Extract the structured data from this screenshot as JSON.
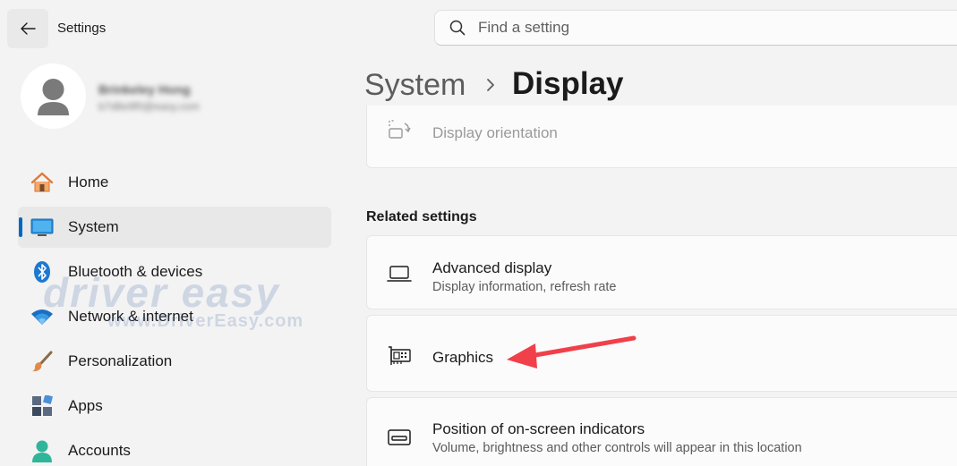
{
  "app": {
    "title": "Settings"
  },
  "search": {
    "placeholder": "Find a setting"
  },
  "profile": {
    "name": "Brinkeley Hong",
    "email": "b7d8e9f0@easy.com"
  },
  "sidebar": {
    "items": [
      {
        "label": "Home",
        "icon": "home-icon",
        "active": false
      },
      {
        "label": "System",
        "icon": "system-monitor-icon",
        "active": true
      },
      {
        "label": "Bluetooth & devices",
        "icon": "bluetooth-icon",
        "active": false
      },
      {
        "label": "Network & internet",
        "icon": "wifi-icon",
        "active": false
      },
      {
        "label": "Personalization",
        "icon": "brush-icon",
        "active": false
      },
      {
        "label": "Apps",
        "icon": "apps-icon",
        "active": false
      },
      {
        "label": "Accounts",
        "icon": "account-icon",
        "active": false
      }
    ]
  },
  "breadcrumb": {
    "parent": "System",
    "current": "Display"
  },
  "content": {
    "top_item": {
      "title": "Display orientation",
      "icon": "orientation-icon"
    },
    "related_title": "Related settings",
    "related": [
      {
        "title": "Advanced display",
        "subtitle": "Display information, refresh rate",
        "icon": "laptop-icon"
      },
      {
        "title": "Graphics",
        "subtitle": "",
        "icon": "graphics-card-icon"
      },
      {
        "title": "Position of on-screen indicators",
        "subtitle": "Volume, brightness and other controls will appear in this location",
        "icon": "screen-indicator-icon"
      }
    ]
  },
  "watermark": {
    "text": "driver easy",
    "url": "www.DriverEasy.com"
  },
  "colors": {
    "accent": "#0067c0",
    "annotation_arrow": "#f0404a"
  }
}
